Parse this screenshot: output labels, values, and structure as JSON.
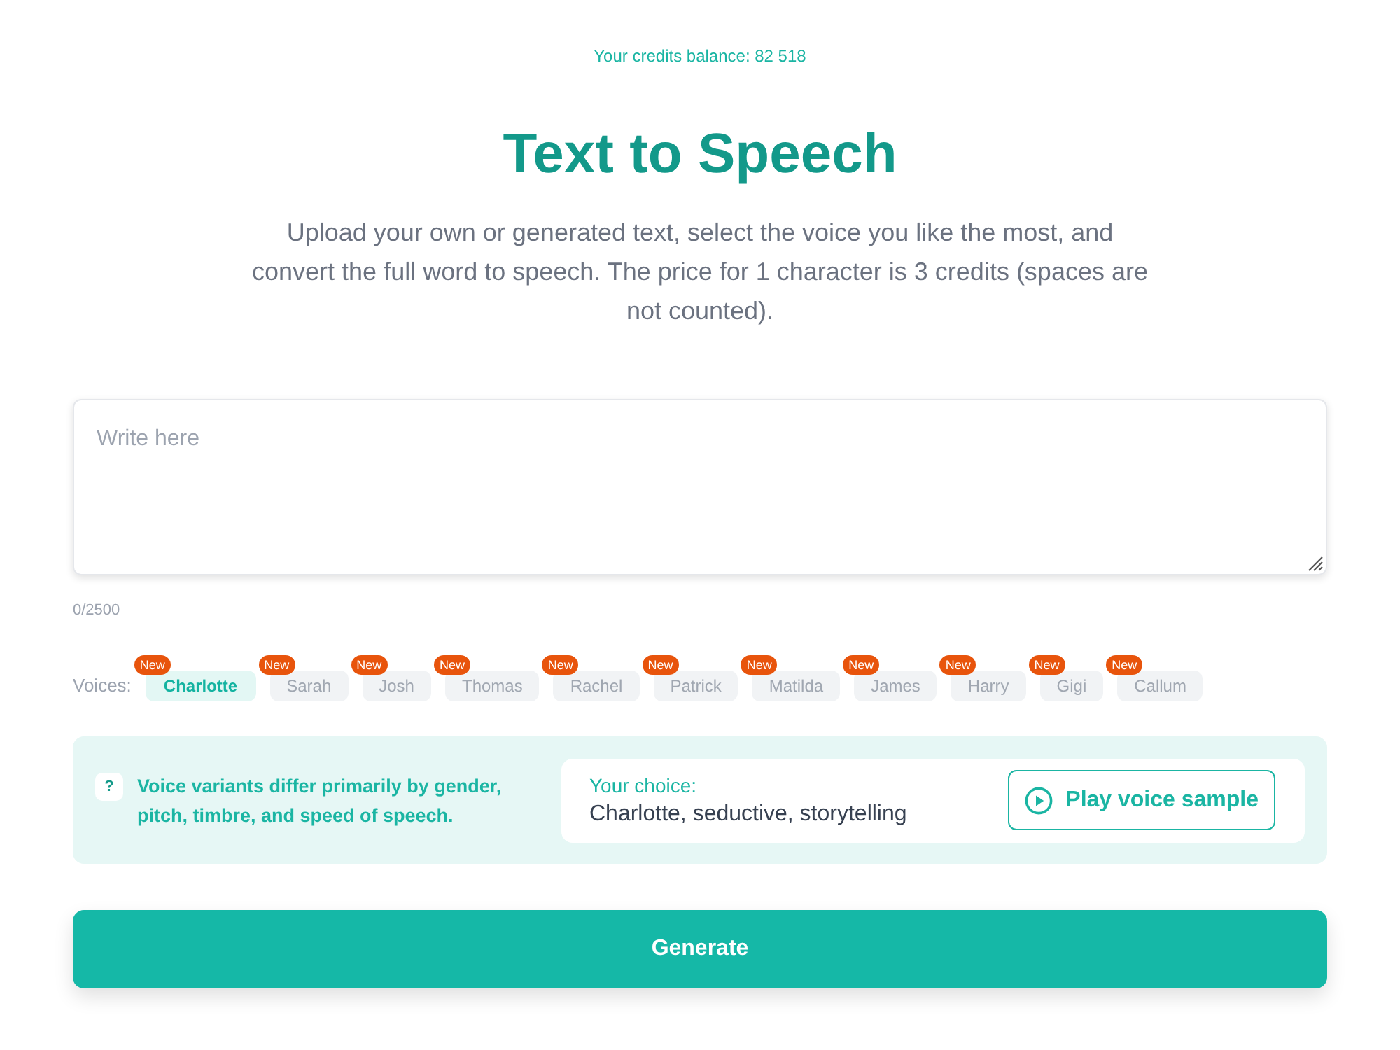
{
  "credits": "Your credits balance: 82 518",
  "title": "Text to Speech",
  "description": "Upload your own or generated text, select the voice you like the most, and convert the full word to speech. The price for 1 character is 3 credits (spaces are not counted).",
  "editor": {
    "placeholder": "Write here",
    "counter": "0/2500"
  },
  "voices": {
    "label": "Voices:",
    "items": [
      {
        "name": "Charlotte",
        "badge": "New",
        "selected": true
      },
      {
        "name": "Sarah",
        "badge": "New",
        "selected": false
      },
      {
        "name": "Josh",
        "badge": "New",
        "selected": false
      },
      {
        "name": "Thomas",
        "badge": "New",
        "selected": false
      },
      {
        "name": "Rachel",
        "badge": "New",
        "selected": false
      },
      {
        "name": "Patrick",
        "badge": "New",
        "selected": false
      },
      {
        "name": "Matilda",
        "badge": "New",
        "selected": false
      },
      {
        "name": "James",
        "badge": "New",
        "selected": false
      },
      {
        "name": "Harry",
        "badge": "New",
        "selected": false
      },
      {
        "name": "Gigi",
        "badge": "New",
        "selected": false
      },
      {
        "name": "Callum",
        "badge": "New",
        "selected": false
      }
    ]
  },
  "info": {
    "help_mark": "?",
    "hint": "Voice variants differ primarily by gender, pitch, timbre, and speed of speech.",
    "choice_label": "Your choice:",
    "choice_value": "Charlotte, seductive, storytelling",
    "play_button": "Play voice sample"
  },
  "generate_button": "Generate"
}
